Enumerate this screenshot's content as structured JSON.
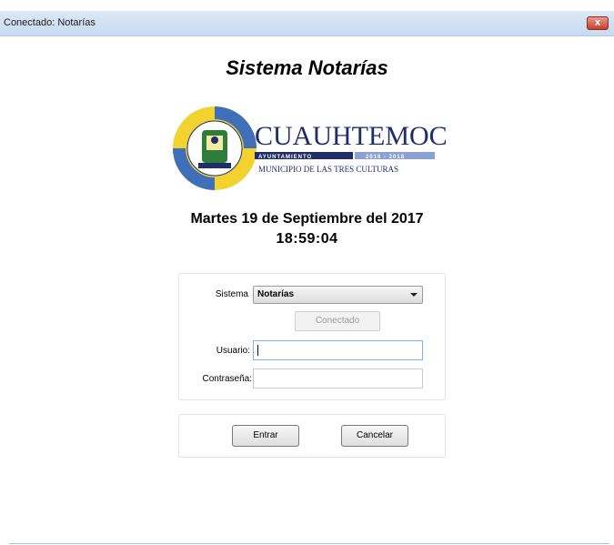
{
  "window": {
    "title": "Conectado: Notarías",
    "close_label": "x"
  },
  "app_title": "Sistema Notarías",
  "logo": {
    "name": "CUAUHTEMOC",
    "band_left": "AYUNTAMIENTO",
    "band_right": "2016 - 2018",
    "tagline": "MUNICIPIO DE LAS TRES CULTURAS",
    "colors": {
      "navy": "#1f2d6b",
      "yellow": "#f2d22e",
      "blue": "#3e6fb8",
      "green": "#2e7d3a"
    }
  },
  "date_line": "Martes 19 de Septiembre del 2017",
  "time_line": "18:59:04",
  "form": {
    "sistema_label": "Sistema",
    "sistema_value": "Notarías",
    "conectado_button": "Conectado",
    "usuario_label": "Usuario:",
    "usuario_value": "",
    "contrasena_label": "Contraseña:",
    "contrasena_value": ""
  },
  "buttons": {
    "entrar": "Entrar",
    "cancelar": "Cancelar"
  }
}
